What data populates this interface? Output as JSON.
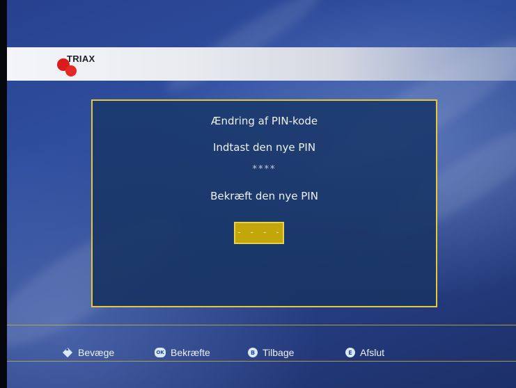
{
  "brand": {
    "logo_text": "TRIAX"
  },
  "dialog": {
    "title": "Ændring af PIN-kode",
    "enter_prompt": "Indtast den nye PIN",
    "entered_mask": "****",
    "confirm_prompt": "Bekræft den nye PIN",
    "pin_field_value": "- - - -"
  },
  "footer": {
    "hints": [
      {
        "key": "arrows",
        "label": "Bevæge"
      },
      {
        "key": "ok",
        "label": "Bekræfte"
      },
      {
        "key": "blue",
        "label": "Tilbage"
      },
      {
        "key": "exit",
        "label": "Afslut"
      }
    ]
  },
  "colors": {
    "dialog_border": "#e6c93a",
    "pin_field": "#c2a60a",
    "background": "#2a478f",
    "logo_red": "#d81b1b"
  }
}
